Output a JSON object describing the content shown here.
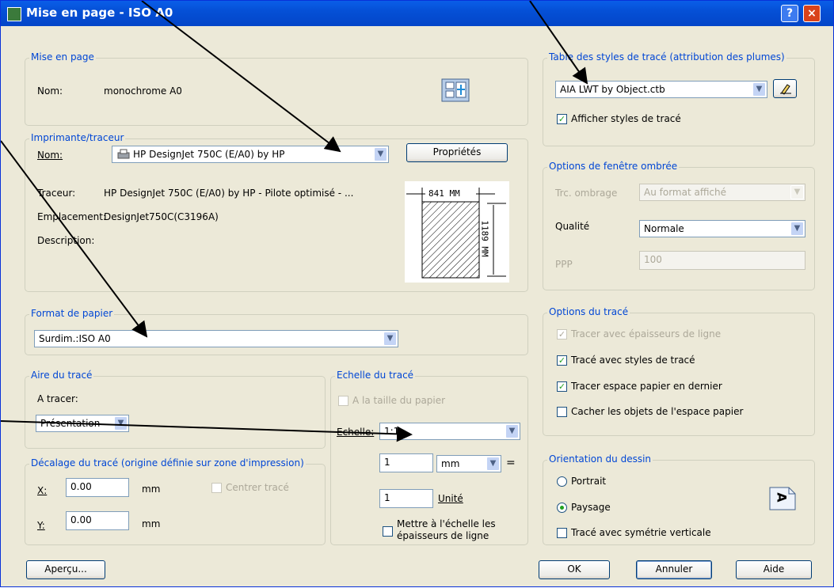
{
  "window": {
    "title": "Mise en page - ISO A0",
    "help_label": "?",
    "close_label": "×"
  },
  "mise_en_page": {
    "group": "Mise en page",
    "nom_label": "Nom:",
    "nom_value": "monochrome A0"
  },
  "imprimante": {
    "group": "Imprimante/traceur",
    "nom_label": "Nom:",
    "nom_value": "HP DesignJet 750C (E/A0) by HP",
    "proprietes_label": "Propriétés",
    "traceur_label": "Traceur:",
    "traceur_value": "HP DesignJet 750C (E/A0) by HP - Pilote optimisé - ...",
    "emplacement_label": "Emplacement:",
    "emplacement_value": "DesignJet750C(C3196A)",
    "description_label": "Description:",
    "preview_width": "841 MM",
    "preview_height": "1189 MM"
  },
  "format": {
    "group": "Format de papier",
    "value": "Surdim.:ISO A0"
  },
  "aire": {
    "group": "Aire du tracé",
    "label": "A tracer:",
    "value": "Présentation"
  },
  "echelle": {
    "group": "Echelle du tracé",
    "taille_label": "A la taille du papier",
    "taille_checked": false,
    "echelle_label": "Echelle:",
    "echelle_value": "1:1",
    "num_value": "1",
    "unit_value": "mm",
    "equals": "=",
    "den_value": "1",
    "unite_label": "Unité",
    "mettre_label_1": "Mettre à l'échelle les",
    "mettre_label_2": "épaisseurs de ligne",
    "mettre_checked": false
  },
  "decalage": {
    "group": "Décalage du tracé (origine définie sur zone d'impression)",
    "x_label": "X:",
    "x_value": "0.00",
    "x_unit": "mm",
    "y_label": "Y:",
    "y_value": "0.00",
    "y_unit": "mm",
    "centrer_label": "Centrer tracé"
  },
  "styles": {
    "group": "Table des styles de tracé (attribution des plumes)",
    "value": "AIA LWT by Object.ctb",
    "afficher_label": "Afficher styles de tracé",
    "afficher_checked": true
  },
  "fenetre": {
    "group": "Options de fenêtre ombrée",
    "trc_label": "Trc. ombrage",
    "trc_value": "Au format affiché",
    "qualite_label": "Qualité",
    "qualite_value": "Normale",
    "ppp_label": "PPP",
    "ppp_value": "100"
  },
  "options": {
    "group": "Options du tracé",
    "items": [
      {
        "label": "Tracer avec épaisseurs de ligne",
        "checked": true,
        "disabled": true
      },
      {
        "label": "Tracé avec styles de tracé",
        "checked": true,
        "disabled": false
      },
      {
        "label": "Tracer espace papier en dernier",
        "checked": true,
        "disabled": false
      },
      {
        "label": "Cacher les objets de l'espace papier",
        "checked": false,
        "disabled": false
      }
    ]
  },
  "orientation": {
    "group": "Orientation du dessin",
    "portrait_label": "Portrait",
    "paysage_label": "Paysage",
    "symetrie_label": "Tracé avec symétrie verticale",
    "selected": "Paysage",
    "icon_letter": "A"
  },
  "buttons": {
    "apercu": "Aperçu...",
    "ok": "OK",
    "annuler": "Annuler",
    "aide": "Aide"
  },
  "colors": {
    "title_bar": "#0550d6",
    "dialog_bg": "#ece9d8",
    "group_label": "#0046d5"
  }
}
